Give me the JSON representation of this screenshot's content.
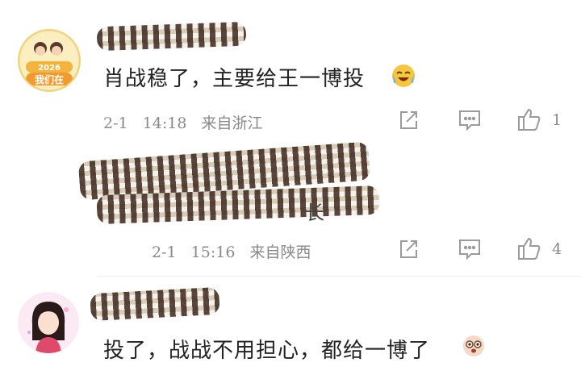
{
  "comments": [
    {
      "avatar_text": "2026\n我们在",
      "text": "肖战稳了，主要给王一博投",
      "date": "2-1",
      "time": "14:18",
      "location": "来自浙江",
      "likes": "1",
      "emoji": "laughing-crying-emoji"
    },
    {
      "text_tail": "长",
      "date": "2-1",
      "time": "15:16",
      "location": "来自陕西",
      "likes": "4"
    },
    {
      "text": "投了，战战不用担心，都给一博了",
      "emoji": "surprised-face-emoji"
    }
  ],
  "colors": {
    "meta": "#8a8a8a",
    "text": "#222222",
    "icon": "#9a9a9a"
  }
}
